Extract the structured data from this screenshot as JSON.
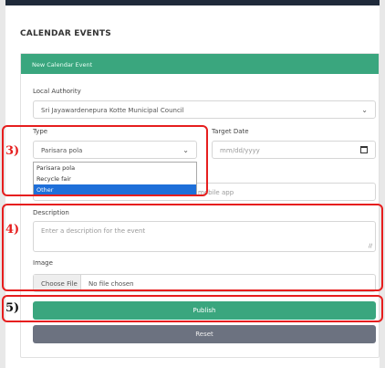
{
  "page_title": "CALENDAR EVENTS",
  "card_title": "New Calendar Event",
  "local_authority": {
    "label": "Local Authority",
    "value": "Sri Jayawardenepura Kotte Municipal Council"
  },
  "type": {
    "label": "Type",
    "value": "Parisara pola",
    "options": [
      "Parisara pola",
      "Recycle fair",
      "Other"
    ],
    "highlighted": "Other"
  },
  "target_date": {
    "label": "Target Date",
    "placeholder": "mm/dd/yyyy"
  },
  "partial_field_text": "mobile app",
  "description": {
    "label": "Description",
    "placeholder": "Enter a description for the event"
  },
  "image": {
    "label": "Image",
    "button": "Choose File",
    "status": "No file chosen"
  },
  "buttons": {
    "publish": "Publish",
    "reset": "Reset"
  },
  "callouts": [
    "3)",
    "4)",
    "5)"
  ],
  "colors": {
    "accent": "#3aa67e",
    "reset": "#6c7280",
    "callout": "#e61e1e",
    "selected_option": "#1e6fd9"
  },
  "icons": [
    "chevron-down-icon",
    "calendar-icon",
    "resize-handle-icon"
  ]
}
